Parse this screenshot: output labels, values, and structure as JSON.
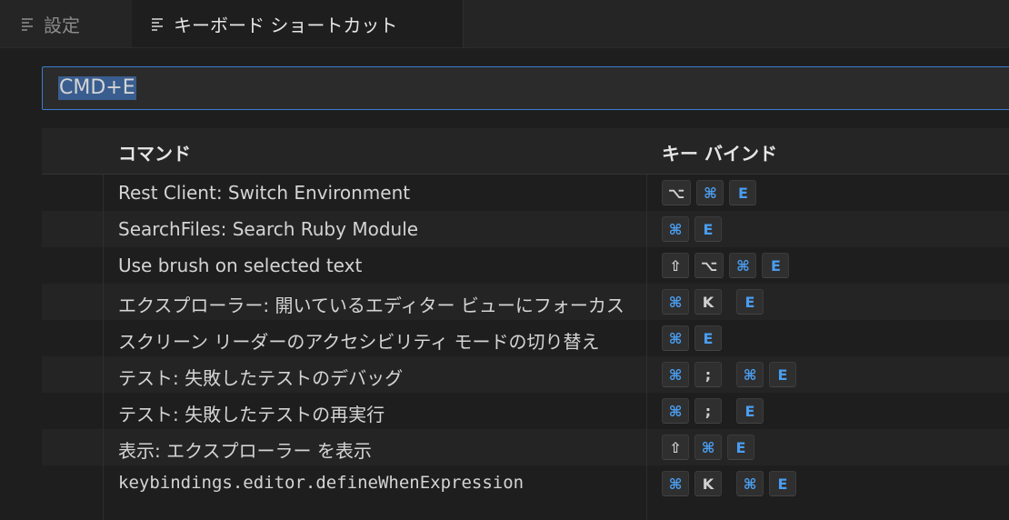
{
  "tabs": [
    {
      "label": "設定"
    },
    {
      "label": "キーボード ショートカット"
    }
  ],
  "search": {
    "value": "CMD+E"
  },
  "table": {
    "headers": {
      "command": "コマンド",
      "keybinding": "キー バインド"
    },
    "rows": [
      {
        "command": "Rest Client: Switch Environment",
        "keys": [
          "⌥",
          "⌘",
          "E"
        ]
      },
      {
        "command": "SearchFiles: Search Ruby Module",
        "keys": [
          "⌘",
          "E"
        ]
      },
      {
        "command": "Use brush on selected text",
        "keys": [
          "⇧",
          "⌥",
          "⌘",
          "E"
        ]
      },
      {
        "command": "エクスプローラー: 開いているエディター ビューにフォーカス",
        "keys": [
          "⌘",
          "K",
          "",
          "E"
        ]
      },
      {
        "command": "スクリーン リーダーのアクセシビリティ モードの切り替え",
        "keys": [
          "⌘",
          "E"
        ]
      },
      {
        "command": "テスト: 失敗したテストのデバッグ",
        "keys": [
          "⌘",
          ";",
          "",
          "⌘",
          "E"
        ]
      },
      {
        "command": "テスト: 失敗したテストの再実行",
        "keys": [
          "⌘",
          ";",
          "",
          "E"
        ]
      },
      {
        "command": "表示: エクスプローラー を表示",
        "keys": [
          "⇧",
          "⌘",
          "E"
        ]
      },
      {
        "command": "keybindings.editor.defineWhenExpression",
        "keys": [
          "⌘",
          "K",
          "",
          "⌘",
          "E"
        ]
      }
    ]
  }
}
